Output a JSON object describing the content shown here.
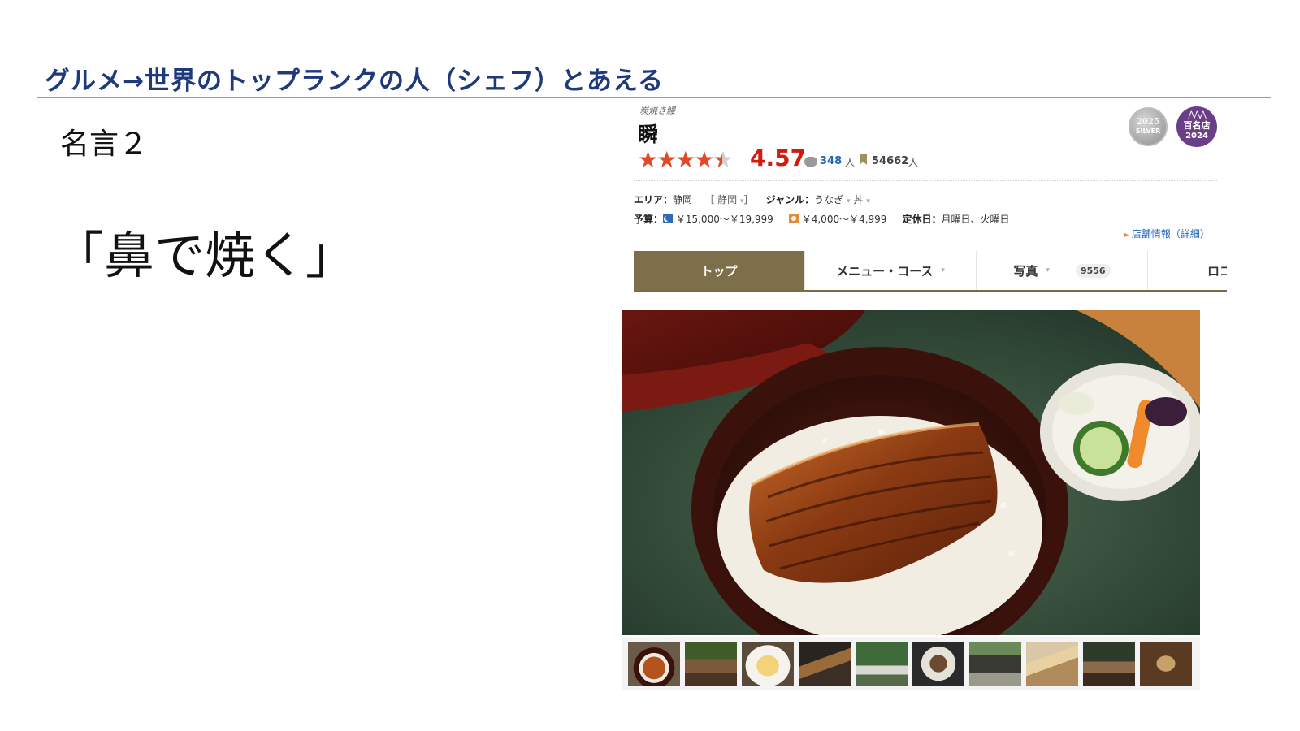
{
  "slide": {
    "title": "グルメ→世界のトップランクの人（シェフ）とあえる",
    "quote_label": "名言２",
    "quote_text": "「鼻で焼く」"
  },
  "restaurant": {
    "genre_small": "炭焼き鰻",
    "name": "瞬",
    "rating": "4.57",
    "rating_value": 4.57,
    "review_count": "348",
    "review_unit": "人",
    "bookmark_count": "54662",
    "bookmark_unit": "人",
    "badges": {
      "silver_year": "2025",
      "silver_label": "SILVER",
      "hyakumeiten_label": "百名店",
      "hyakumeiten_year": "2024"
    },
    "area_label": "エリア：",
    "area_value": "静岡",
    "area_select": "［ 静岡",
    "area_close": "］",
    "genre_label": "ジャンル：",
    "genre_1": "うなぎ",
    "genre_2": "丼",
    "budget_label": "予算：",
    "budget_dinner": "￥15,000～￥19,999",
    "budget_lunch": "￥4,000～￥4,999",
    "closed_label": "定休日：",
    "closed_value": "月曜日、火曜日",
    "store_link": "店舗情報（詳細）"
  },
  "tabs": [
    {
      "label": "トップ",
      "active": true
    },
    {
      "label": "メニュー・コース"
    },
    {
      "label": "写真",
      "count": "9556"
    },
    {
      "label": "ロコ"
    }
  ],
  "colors": {
    "title_blue": "#1f3a7a",
    "rule_gold": "#b39a55",
    "rating_red": "#d21b10",
    "tab_active": "#7d6f49",
    "link_blue": "#2066b8"
  },
  "icons": [
    "star-icon",
    "review-bubble-icon",
    "bookmark-icon",
    "dinner-moon-icon",
    "lunch-sun-icon",
    "caret-down-icon"
  ]
}
